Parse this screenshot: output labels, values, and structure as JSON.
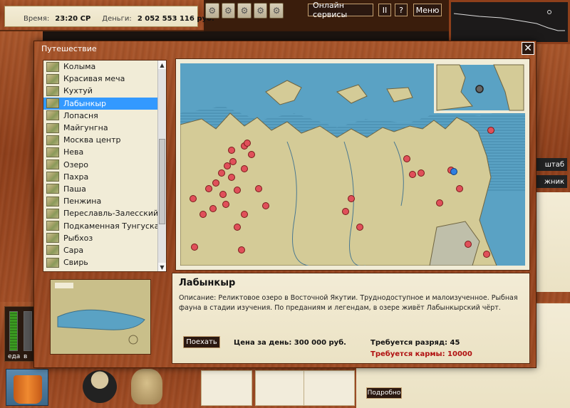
{
  "status": {
    "time_label": "Время:",
    "time_value": "23:20 СР",
    "money_label": "Деньги:",
    "money_value": "2 052 553 116 руб."
  },
  "top_buttons": {
    "online": "Онлайн сервисы",
    "pause": "II",
    "help": "?",
    "menu": "Меню"
  },
  "right_tabs": {
    "scale": "штаб",
    "guide": "жник"
  },
  "hud": {
    "food_label": "еда",
    "water_label": "в"
  },
  "bottom": {
    "detail_button": "Подробно"
  },
  "dialog": {
    "title": "Путешествие",
    "close": "✕"
  },
  "locations": [
    "Колыма",
    "Красивая меча",
    "Кухтуй",
    "Лабынкыр",
    "Лопасня",
    "Майгунгна",
    "Москва центр",
    "Нева",
    "Озеро",
    "Пахра",
    "Паша",
    "Пенжина",
    "Переславль-Залесский",
    "Подкаменная Тунгуска",
    "Рыбхоз",
    "Сара",
    "Свирь"
  ],
  "selected_location_index": 3,
  "info": {
    "name": "Лабынкыр",
    "description": "Описание: Реликтовое озеро в Восточной Якутии. Труднодоступное и малоизученное. Рыбная фауна в стадии изучения. По преданиям и легендам, в озере живёт Лабынкырский чёрт.",
    "go_button": "Поехать",
    "price": "Цена за день: 300 000 руб.",
    "rank": "Требуется разряд: 45",
    "karma": "Требуется кармы: 10000"
  },
  "colors": {
    "selection": "#3399ff",
    "karma": "#b01010",
    "sea": "#5aa2c4",
    "land": "#d4cb97",
    "marker": "#e0505a",
    "current_marker": "#2f7fe0"
  }
}
